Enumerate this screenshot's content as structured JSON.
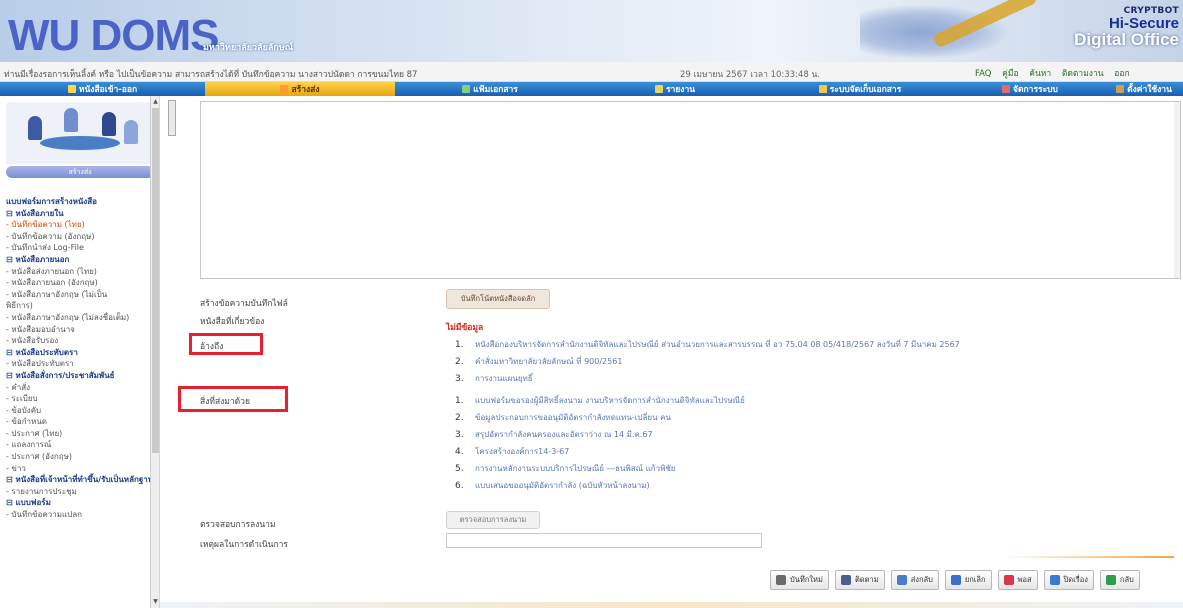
{
  "header": {
    "logo_text": "WU DOMS",
    "logo_subtitle": "มหาวิทยาลัยวลัยลักษณ์",
    "brand_top": "CRYPTBOT",
    "brand_middle": "Hi-Secure",
    "brand_bottom": "Digital Office"
  },
  "infobar": {
    "path": "ท่านมีเรื่องรอการเห็นลิ้งค์ หรือ ไปเป็นข้อความ สามารถสร้างได้ที่ บันทึกข้อความ นางสาวปนัดดา การขนมไทย 87",
    "date": "29 เมษายน 2567 เวลา 10:33:48 น.",
    "links": [
      "FAQ",
      "คู่มือ",
      "ค้นหา",
      "ติดตามงาน",
      "ออก"
    ]
  },
  "nav": {
    "items": [
      {
        "label": "หนังสือเข้า-ออก",
        "width": 205,
        "color": "#ffd64a"
      },
      {
        "label": "สร้างส่ง",
        "width": 190,
        "color": "#ff9a2e",
        "active": true
      },
      {
        "label": "แฟ้มเอกสาร",
        "width": 190,
        "color": "#7fd37f"
      },
      {
        "label": "รายงาน",
        "width": 180,
        "color": "#e8d36a"
      },
      {
        "label": "ระบบจัดเก็บเอกสาร",
        "width": 190,
        "color": "#f2c94c"
      },
      {
        "label": "จัดการระบบ",
        "width": 150,
        "color": "#e56a6a"
      },
      {
        "label": "ตั้งค่าใช้งาน",
        "width": 78,
        "color": "#c7a15a"
      }
    ]
  },
  "sidebar": {
    "banner": "สร้างส่ง",
    "menu": [
      {
        "kind": "title",
        "text": "แบบฟอร์มการสร้างหนังสือ"
      },
      {
        "kind": "grp",
        "text": "⊟ หนังสือภายใน"
      },
      {
        "kind": "cur",
        "text": "- บันทึกข้อความ (ไทย)"
      },
      {
        "kind": "lnk",
        "text": "- บันทึกข้อความ (อังกฤษ)"
      },
      {
        "kind": "lnk",
        "text": "- บันทึกนำส่ง Log-File"
      },
      {
        "kind": "grp",
        "text": "⊟ หนังสือภายนอก"
      },
      {
        "kind": "lnk",
        "text": "- หนังสือส่งภายนอก (ไทย)"
      },
      {
        "kind": "lnk",
        "text": "- หนังสือภายนอก (อังกฤษ)"
      },
      {
        "kind": "lnk",
        "text": "- หนังสือภาษาอังกฤษ (ไม่เป็น"
      },
      {
        "kind": "lnk",
        "text": "  พิธีการ)"
      },
      {
        "kind": "lnk",
        "text": "- หนังสือภาษาอังกฤษ (ไม่ลงชื่อเต็ม)"
      },
      {
        "kind": "lnk",
        "text": "- หนังสือมอบอำนาจ"
      },
      {
        "kind": "lnk",
        "text": "- หนังสือรับรอง"
      },
      {
        "kind": "grp",
        "text": "⊟ หนังสือประทับตรา"
      },
      {
        "kind": "lnk",
        "text": "- หนังสือประทับตรา"
      },
      {
        "kind": "grp",
        "text": "⊟ หนังสือสั่งการ/ประชาสัมพันธ์"
      },
      {
        "kind": "lnk",
        "text": "- คำสั่ง"
      },
      {
        "kind": "lnk",
        "text": "- ระเบียบ"
      },
      {
        "kind": "lnk",
        "text": "- ข้อบังคับ"
      },
      {
        "kind": "lnk",
        "text": "- ข้อกำหนด"
      },
      {
        "kind": "lnk",
        "text": "- ประกาศ (ไทย)"
      },
      {
        "kind": "lnk",
        "text": "- แถลงการณ์"
      },
      {
        "kind": "lnk",
        "text": "- ประกาศ (อังกฤษ)"
      },
      {
        "kind": "lnk",
        "text": "- ข่าว"
      },
      {
        "kind": "grp",
        "text": "⊟ หนังสือที่เจ้าหน้าที่ทำขึ้น/รับเป็นหลักฐาน"
      },
      {
        "kind": "lnk",
        "text": "- รายงานการประชุม"
      },
      {
        "kind": "grp",
        "text": "⊟ แบบฟอร์ม"
      },
      {
        "kind": "lnk",
        "text": "- บันทึกข้อความแปลก"
      }
    ]
  },
  "form": {
    "create_from_label": "สร้างข้อความบันทึกไฟล์",
    "create_from_button": "บันทึกโน้ตหนังสือจดลัก",
    "related_label": "หนังสือที่เกี่ยวข้อง",
    "related_link": "ไม่มีข้อมูล",
    "refer_label": "อ้างถึง",
    "refer_items": [
      "หนังสือกองบริหารจัดการสำนักงานดิจิทัลและไปรษณีย์ ส่วนอำนวยการและสารบรรณ ที่ อว 75.04 08 05/418/2567 ลงวันที่ 7 มีนาคม 2567",
      "คำสั่งมหาวิทยาลัยวลัยลักษณ์ ที่ 900/2561",
      "การงานแผนยุทธิ์"
    ],
    "attach_label": "สิ่งที่ส่งมาด้วย",
    "attach_items": [
      "แบบฟอร์มขอรองผู้มีสิทธิ์ลงนาม งานบริหารจัดการสำนักงานดิจิทัลและไปรษณีย์",
      "ข้อมูลประกอบการขออนุมัติอัตรากำลังทดแทน-เปลี่ยน คน",
      "สรุปอัตรากำลังคนครองและอัตราว่าง ณ 14 มี.ค.67",
      "โครงสร้างองค์การ14-3-67",
      "การงานหลักงานระบบบริการไปรษณีย์ ---ธนพิสณ์ แก้วพิชัย",
      "แบบเสนอขออนุมัติอัตรากำลัง (ฉบับหัวหน้าลงนาม)"
    ],
    "check_label": "ตรวจสอบการลงนาม",
    "check_button": "ตรวจสอบการลงนาม",
    "reason_label": "เหตุผลในการดำเนินการ",
    "reason_value": ""
  },
  "toolbar": [
    {
      "label": "บันทึกใหม่",
      "color": "#6b6b6b",
      "name": "save-new-button",
      "icon": "save-icon"
    },
    {
      "label": "ติดตาม",
      "color": "#4a5f8a",
      "name": "follow-button",
      "icon": "people-icon"
    },
    {
      "label": "ส่งกลับ",
      "color": "#4b7cc9",
      "name": "send-back-button",
      "icon": "send-icon"
    },
    {
      "label": "ยกเลิก",
      "color": "#3a6fcf",
      "name": "cancel-button",
      "icon": "cancel-icon"
    },
    {
      "label": "พอส",
      "color": "#d8394a",
      "name": "print-button",
      "icon": "document-icon"
    },
    {
      "label": "ปิดเรื่อง",
      "color": "#3b7bcf",
      "name": "close-matter-button",
      "icon": "close-document-icon"
    },
    {
      "label": "กลับ",
      "color": "#2f9c4a",
      "name": "back-button",
      "icon": "back-icon"
    }
  ]
}
